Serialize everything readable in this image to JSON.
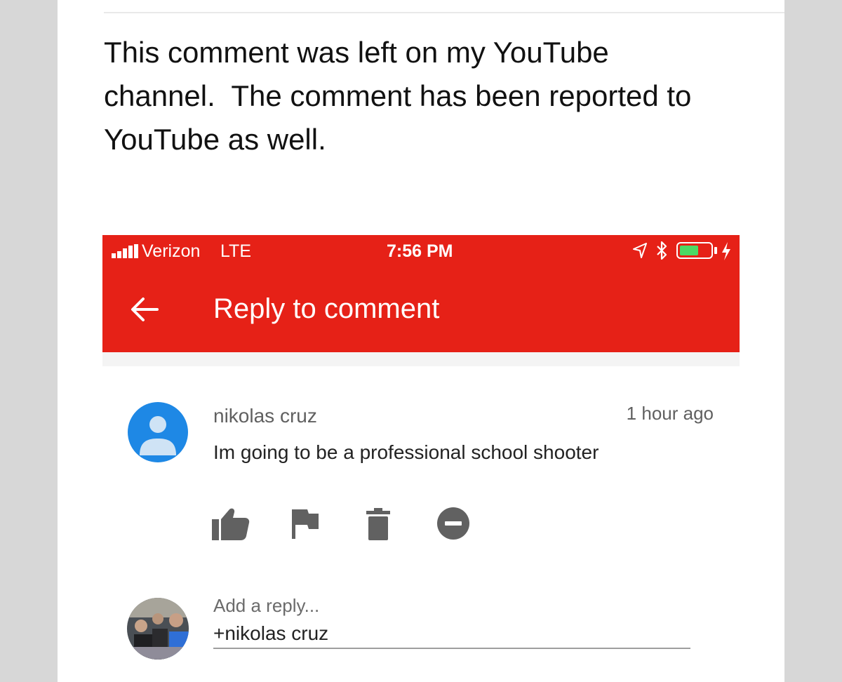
{
  "post": {
    "text": "This comment was left on my YouTube\nchannel.  The comment has been reported to\nYouTube as well."
  },
  "status_bar": {
    "carrier": "Verizon",
    "network": "LTE",
    "time": "7:56 PM",
    "battery_color": "#4cd964"
  },
  "app_bar": {
    "title": "Reply to comment",
    "color": "#e62117"
  },
  "comment": {
    "author": "nikolas cruz",
    "time": "1 hour ago",
    "text": "Im going to be a professional school shooter",
    "avatar_color": "#1e88e5",
    "actions": [
      "thumbs-up-icon",
      "flag-icon",
      "trash-icon",
      "block-icon"
    ]
  },
  "reply": {
    "placeholder": "Add a reply...",
    "value": "+nikolas cruz"
  }
}
